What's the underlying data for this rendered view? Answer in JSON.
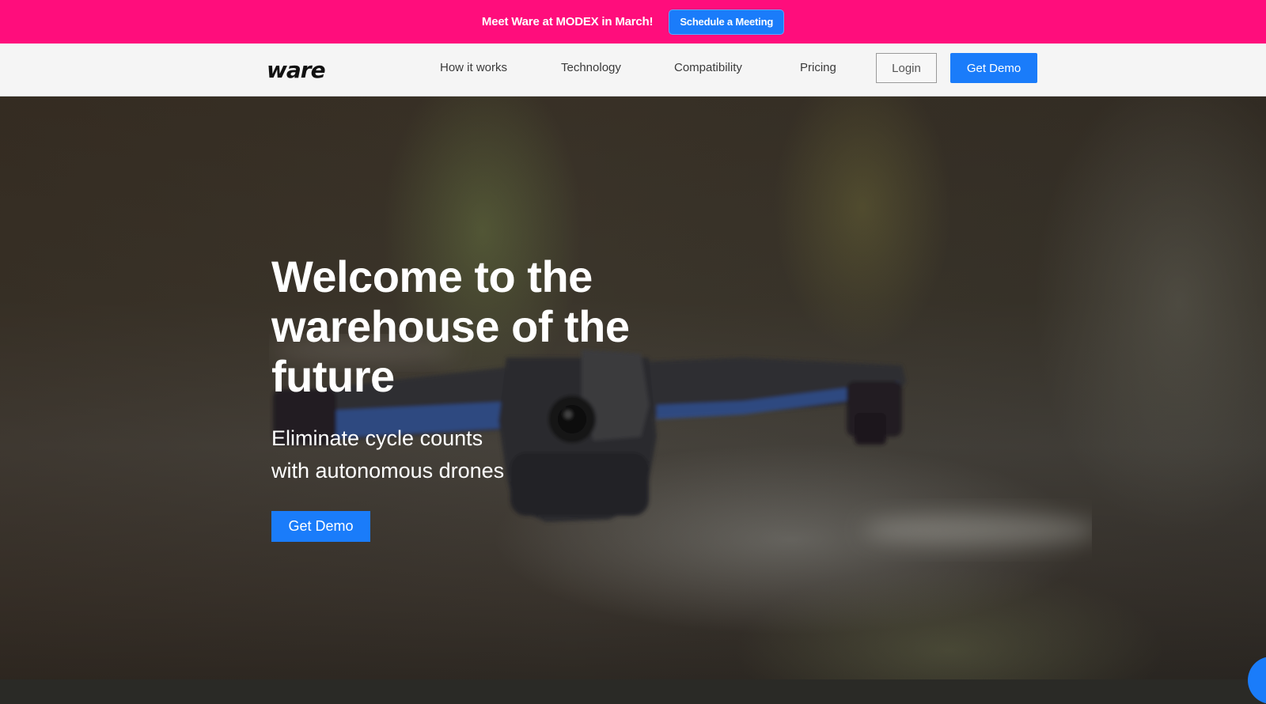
{
  "announcement": {
    "text": "Meet Ware at MODEX in March!",
    "button_label": "Schedule a Meeting"
  },
  "nav": {
    "logo": "ware",
    "links": [
      "How it works",
      "Technology",
      "Compatibility",
      "Pricing"
    ],
    "login_label": "Login",
    "demo_label": "Get Demo"
  },
  "hero": {
    "title": "Welcome to the warehouse of the future",
    "subtitle_line1": "Eliminate cycle counts",
    "subtitle_line2": "with autonomous drones",
    "cta_label": "Get Demo"
  },
  "colors": {
    "announcement_bg": "#ff0d7c",
    "accent_blue": "#1a7cfa",
    "nav_bg": "#f5f5f5"
  }
}
